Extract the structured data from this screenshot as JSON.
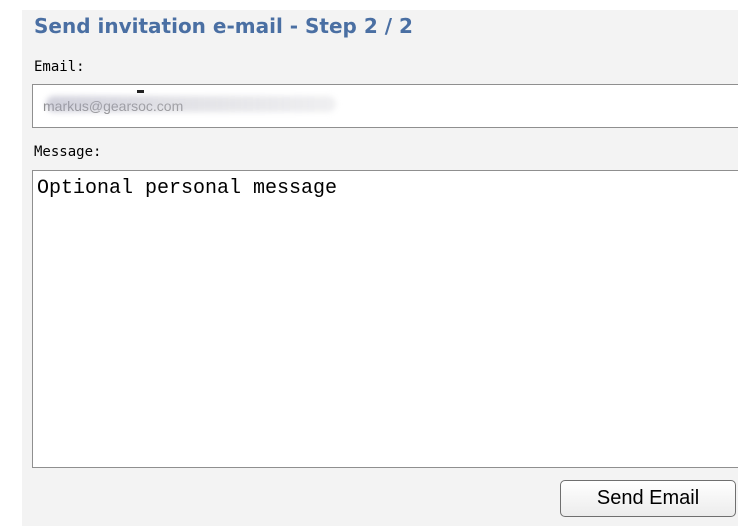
{
  "form": {
    "title": "Send invitation e-mail - Step 2 / 2",
    "email_label": "Email:",
    "email_value": "markus@gearsoc.com",
    "message_label": "Message:",
    "message_placeholder": "Optional personal message",
    "submit_label": "Send Email"
  },
  "colors": {
    "heading": "#4a6fa3",
    "panel_background": "#f3f3f3",
    "field_border": "#8f8f8f"
  }
}
